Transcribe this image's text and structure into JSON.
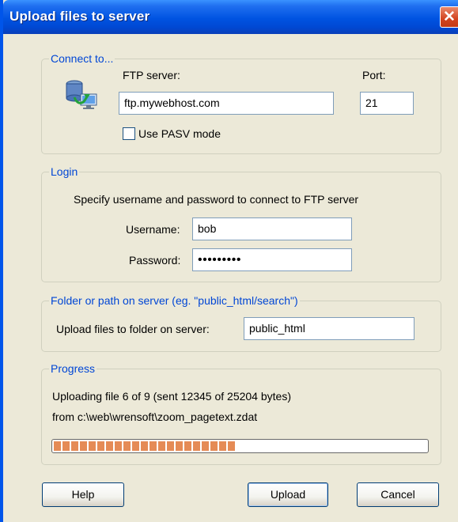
{
  "window": {
    "title": "Upload files to server"
  },
  "connect": {
    "legend": "Connect to...",
    "ftp_label": "FTP server:",
    "ftp_value": "ftp.mywebhost.com",
    "port_label": "Port:",
    "port_value": "21",
    "pasv_label": "Use PASV mode",
    "pasv_checked": false
  },
  "login": {
    "legend": "Login",
    "instruction": "Specify username and password to connect to FTP server",
    "username_label": "Username:",
    "username_value": "bob",
    "password_label": "Password:",
    "password_value": "•••••••••"
  },
  "folder": {
    "legend": "Folder or path on server (eg. \"public_html/search\")",
    "label": "Upload files to folder on server:",
    "value": "public_html"
  },
  "progress": {
    "legend": "Progress",
    "status_line1": "Uploading file 6 of 9 (sent 12345 of 25204 bytes)",
    "status_line2": "from c:\\web\\wrensoft\\zoom_pagetext.zdat",
    "fraction": 0.49
  },
  "buttons": {
    "help": "Help",
    "upload": "Upload",
    "cancel": "Cancel"
  }
}
